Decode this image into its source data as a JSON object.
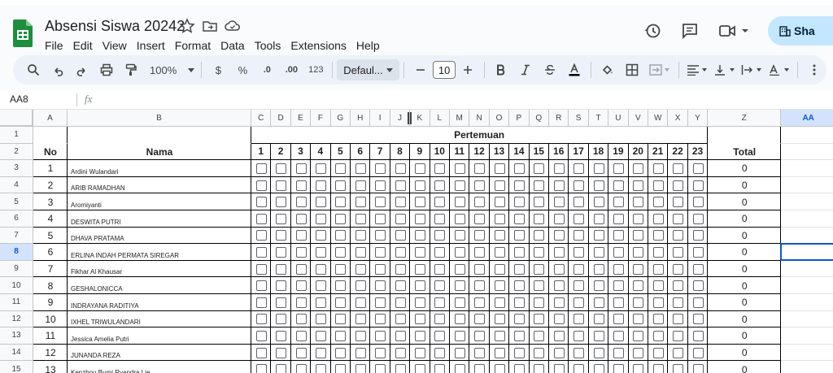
{
  "window": {
    "tab_text": ""
  },
  "doc": {
    "title": "Absensi Siswa 20242"
  },
  "menu": [
    "File",
    "Edit",
    "View",
    "Insert",
    "Format",
    "Data",
    "Tools",
    "Extensions",
    "Help"
  ],
  "share": {
    "label": "Sha"
  },
  "toolbar": {
    "zoom": "100%",
    "currency": "$",
    "percent": "%",
    "dec_decrease": ".0",
    "dec_increase": ".00",
    "number_format": "123",
    "font": "Defaul...",
    "font_size": "10"
  },
  "formula_bar": {
    "cell_ref": "AA8",
    "fx": "fx",
    "value": ""
  },
  "columns": [
    "A",
    "B",
    "C",
    "D",
    "E",
    "F",
    "G",
    "H",
    "I",
    "J",
    "K",
    "L",
    "M",
    "N",
    "O",
    "P",
    "Q",
    "R",
    "S",
    "T",
    "U",
    "V",
    "W",
    "X",
    "Y",
    "Z",
    "AA"
  ],
  "selected_column": "AA",
  "selected_row": "8",
  "rows": [
    "1",
    "2",
    "3",
    "4",
    "5",
    "6",
    "7",
    "8",
    "9",
    "10",
    "11",
    "12",
    "13",
    "14",
    "15"
  ],
  "sheet": {
    "header_no": "No",
    "header_nama": "Nama",
    "header_pertemuan": "Pertemuan",
    "header_total": "Total",
    "meetings": [
      "1",
      "2",
      "3",
      "4",
      "5",
      "6",
      "7",
      "8",
      "9",
      "10",
      "11",
      "12",
      "13",
      "14",
      "15",
      "16",
      "17",
      "18",
      "19",
      "20",
      "21",
      "22",
      "23"
    ],
    "students": [
      {
        "no": "1",
        "name": "Ardini Wulandari",
        "total": "0"
      },
      {
        "no": "2",
        "name": "ARIB RAMADHAN",
        "total": "0"
      },
      {
        "no": "3",
        "name": "Aromiyanti",
        "total": "0"
      },
      {
        "no": "4",
        "name": "DESWITA PUTRI",
        "total": "0"
      },
      {
        "no": "5",
        "name": "DHAVA PRATAMA",
        "total": "0"
      },
      {
        "no": "6",
        "name": "ERLINA INDAH PERMATA SIREGAR",
        "total": "0"
      },
      {
        "no": "7",
        "name": "Fikhar Al Khausar",
        "total": "0"
      },
      {
        "no": "8",
        "name": "GESHALONICCA",
        "total": "0"
      },
      {
        "no": "9",
        "name": "INDRAYANA RADITIYA",
        "total": "0"
      },
      {
        "no": "10",
        "name": "IXHEL TRIWULANDARI",
        "total": "0"
      },
      {
        "no": "11",
        "name": "Jessica Amelia Putri",
        "total": "0"
      },
      {
        "no": "12",
        "name": "JUNANDA REZA",
        "total": "0"
      },
      {
        "no": "13",
        "name": "Kenzhou Bumi Ryandra Lie",
        "total": "0"
      }
    ]
  }
}
